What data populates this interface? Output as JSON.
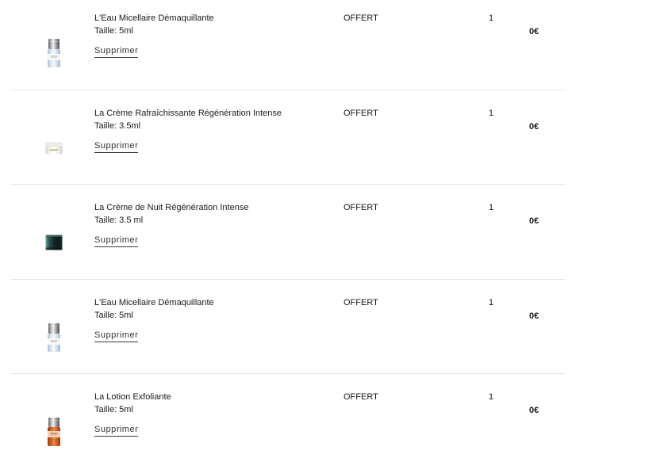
{
  "cart": {
    "items": [
      {
        "name": "L'Eau Micellaire Démaquillante",
        "size": "Taille: 5ml",
        "remove_label": "Supprimer",
        "status": "OFFERT",
        "quantity": "1",
        "price": "0€",
        "image": "micellar-water-bottle-icon"
      },
      {
        "name": "La Crème Rafraîchissante Régénération Intense",
        "size": "Taille: 3.5ml",
        "remove_label": "Supprimer",
        "status": "OFFERT",
        "quantity": "1",
        "price": "0€",
        "image": "white-cream-jar-icon"
      },
      {
        "name": "La Crème de Nuit Régénération Intense",
        "size": "Taille: 3.5 ml",
        "remove_label": "Supprimer",
        "status": "OFFERT",
        "quantity": "1",
        "price": "0€",
        "image": "dark-night-cream-jar-icon"
      },
      {
        "name": "L'Eau Micellaire Démaquillante",
        "size": "Taille: 5ml",
        "remove_label": "Supprimer",
        "status": "OFFERT",
        "quantity": "1",
        "price": "0€",
        "image": "micellar-water-bottle-icon"
      },
      {
        "name": "La Lotion Exfoliante",
        "size": "Taille: 5ml",
        "remove_label": "Supprimer",
        "status": "OFFERT",
        "quantity": "1",
        "price": "0€",
        "image": "exfoliating-lotion-bottle-icon"
      }
    ]
  },
  "colors": {
    "text": "#1a1a1a",
    "divider": "#e2e2e2",
    "background": "#ffffff"
  }
}
